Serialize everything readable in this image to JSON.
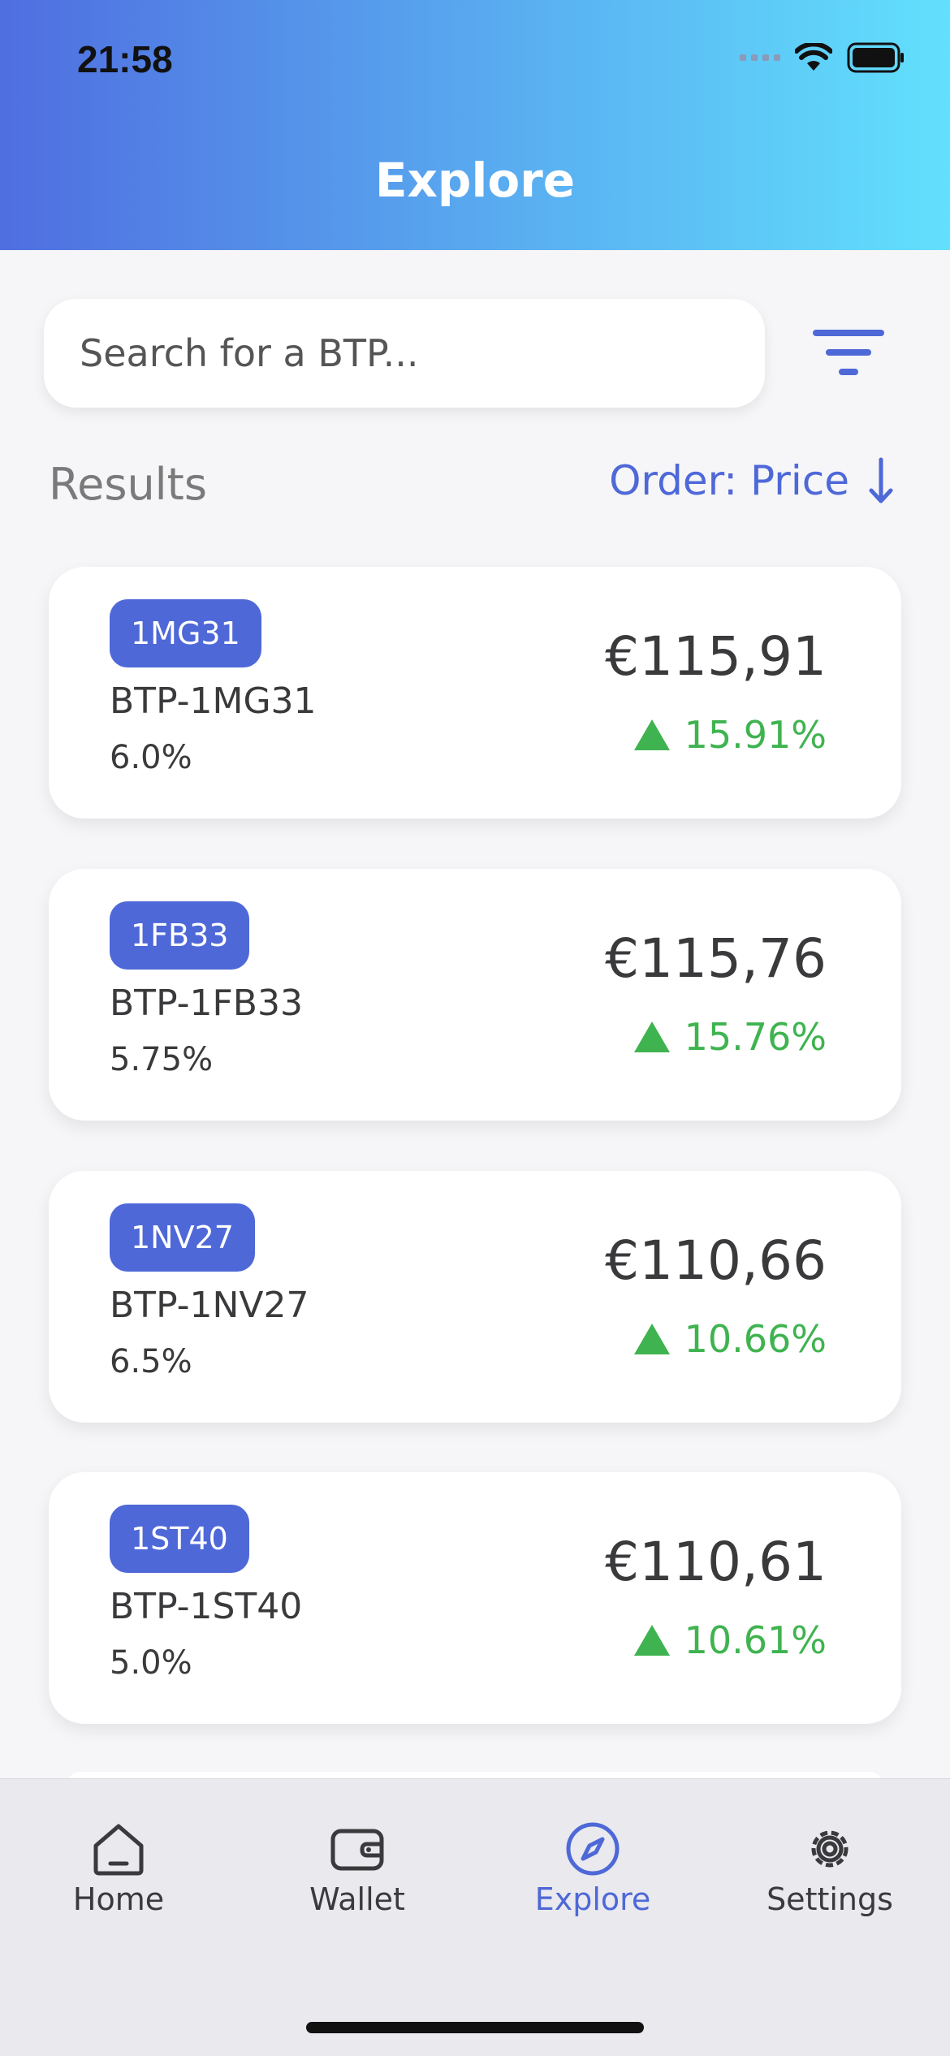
{
  "status_bar": {
    "time": "21:58"
  },
  "header": {
    "title": "Explore",
    "gradient_start": "#4f6ee0",
    "gradient_end": "#62e0fc"
  },
  "search": {
    "placeholder": "Search for a BTP..."
  },
  "results": {
    "label": "Results",
    "order_label": "Order: Price",
    "order_icon": "arrow-down-icon"
  },
  "accent_color": "#4e68d8",
  "positive_color": "#3fb34f",
  "cards": [
    {
      "code": "1MG31",
      "name": "BTP-1MG31",
      "rate": "6.0%",
      "price": "€115,91",
      "change": "15.91%"
    },
    {
      "code": "1FB33",
      "name": "BTP-1FB33",
      "rate": "5.75%",
      "price": "€115,76",
      "change": "15.76%"
    },
    {
      "code": "1NV27",
      "name": "BTP-1NV27",
      "rate": "6.5%",
      "price": "€110,66",
      "change": "10.66%"
    },
    {
      "code": "1ST40",
      "name": "BTP-1ST40",
      "rate": "5.0%",
      "price": "€110,61",
      "change": "10.61%"
    }
  ],
  "tabbar": {
    "items": [
      {
        "label": "Home",
        "icon": "home-icon"
      },
      {
        "label": "Wallet",
        "icon": "wallet-icon"
      },
      {
        "label": "Explore",
        "icon": "compass-icon",
        "active": true
      },
      {
        "label": "Settings",
        "icon": "gear-icon"
      }
    ]
  }
}
